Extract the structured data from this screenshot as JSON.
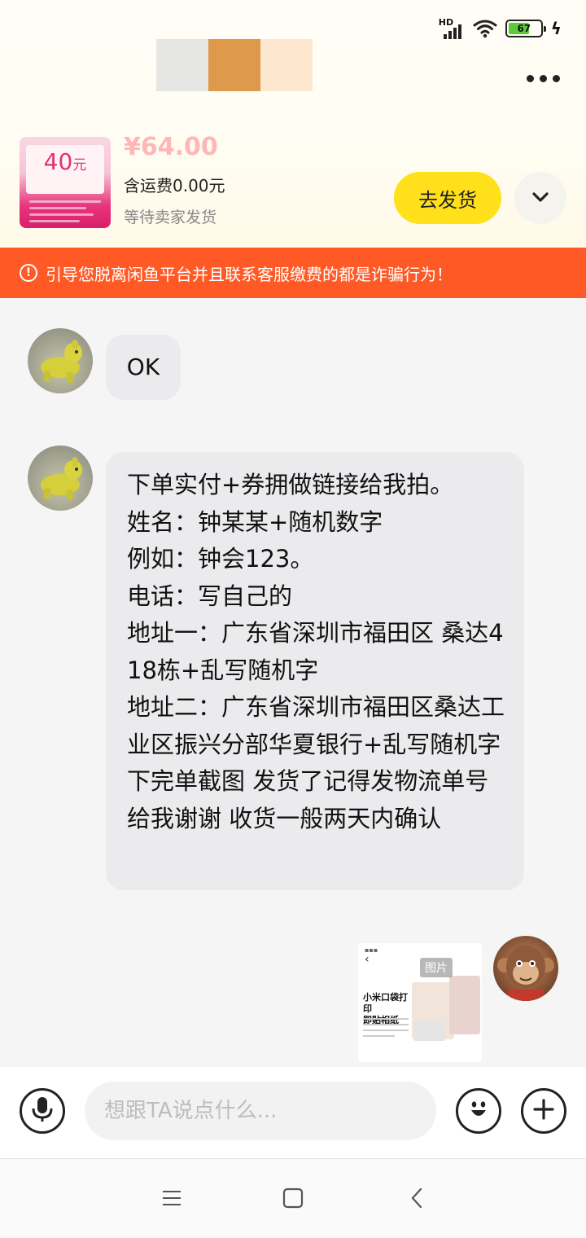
{
  "status_bar": {
    "network": "HD",
    "battery": "67"
  },
  "header": {
    "swatch_colors": [
      "#e6e6e4",
      "#de9a4a",
      "#fde8cf"
    ]
  },
  "product": {
    "thumb_label": "40元",
    "thumb_label_amount": "40",
    "thumb_label_unit": "元",
    "price": "¥64.00",
    "shipping": "含运费0.00元",
    "status": "等待卖家发货",
    "ship_button_label": "去发货"
  },
  "warning": {
    "text": "引导您脱离闲鱼平台并且联系客服缴费的都是诈骗行为！"
  },
  "messages": [
    {
      "from": "other",
      "text": "OK"
    },
    {
      "from": "other",
      "text": "下单实付+券拥做链接给我拍。\n姓名：钟某某+随机数字\n例如：钟会123。\n电话：写自己的\n地址一：广东省深圳市福田区 桑达418栋+乱写随机字\n地址二：广东省深圳市福田区桑达工业区振兴分部华夏银行+乱写随机字\n下完单截图 发货了记得发物流单号给我谢谢 收货一般两天内确认"
    },
    {
      "from": "me",
      "type": "image",
      "image_label": "图片",
      "image_title": "小米口袋打印\n即贴相纸"
    }
  ],
  "input": {
    "placeholder": "想跟TA说点什么..."
  },
  "colors": {
    "accent_yellow": "#ffe01b",
    "warning_orange": "#ff5a26",
    "bubble_gray": "#ebebed"
  }
}
